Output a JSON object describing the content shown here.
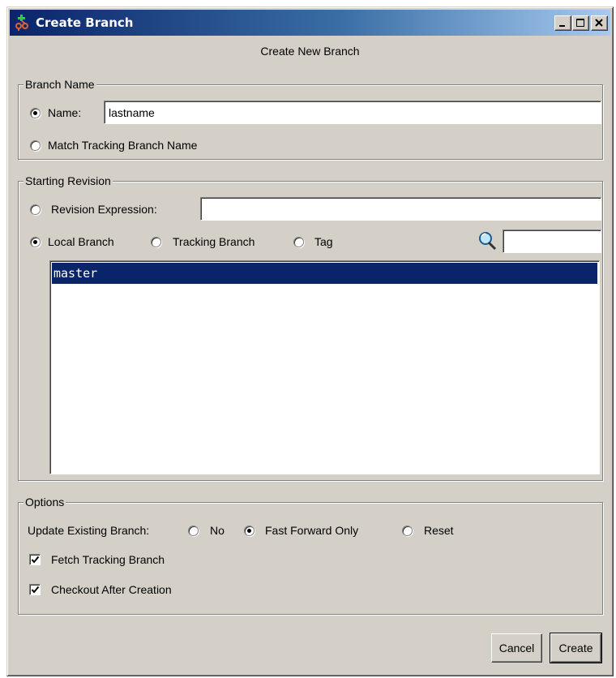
{
  "window": {
    "title": "Create Branch",
    "minimize_icon": "minimize-icon",
    "maximize_icon": "maximize-icon",
    "close_icon": "close-icon"
  },
  "heading": "Create New Branch",
  "branch_name": {
    "legend": "Branch Name",
    "name_label": "Name:",
    "name_value": "lastname",
    "name_selected": true,
    "match_label": "Match Tracking Branch Name",
    "match_selected": false
  },
  "starting_revision": {
    "legend": "Starting Revision",
    "revision_expression_label": "Revision Expression:",
    "revision_expression_value": "",
    "local_branch_label": "Local Branch",
    "tracking_branch_label": "Tracking Branch",
    "tag_label": "Tag",
    "selected_source": "Local Branch",
    "filter_icon": "search-icon",
    "filter_value": "",
    "branches": [
      "master"
    ],
    "selected_branch": "master"
  },
  "options": {
    "legend": "Options",
    "update_label": "Update Existing Branch:",
    "update_choices": [
      "No",
      "Fast Forward Only",
      "Reset"
    ],
    "update_selected": "Fast Forward Only",
    "fetch_label": "Fetch Tracking Branch",
    "fetch_checked": true,
    "checkout_label": "Checkout After Creation",
    "checkout_checked": true
  },
  "buttons": {
    "cancel": "Cancel",
    "create": "Create"
  },
  "colors": {
    "face": "#d4d0c8",
    "selection": "#0a246a",
    "titlebar_start": "#0a246a",
    "titlebar_end": "#a6caf0"
  }
}
